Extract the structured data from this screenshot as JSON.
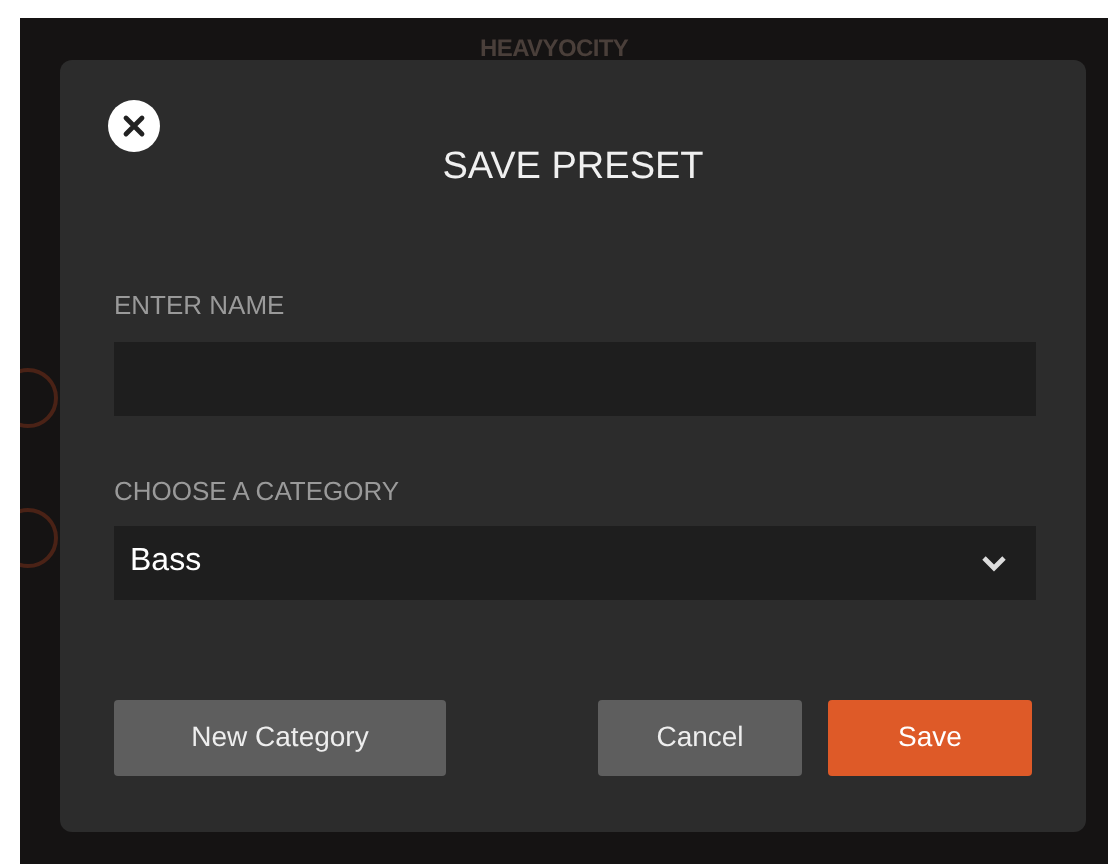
{
  "background": {
    "brand": "HEAVYOCITY"
  },
  "dialog": {
    "title": "SAVE PRESET",
    "name_field": {
      "label": "ENTER NAME"
    },
    "category_field": {
      "label": "CHOOSE A CATEGORY",
      "value": "Bass"
    },
    "buttons": [
      {
        "label": "New Category",
        "kind": "secondary"
      },
      {
        "label": "Cancel",
        "kind": "secondary"
      },
      {
        "label": "Save",
        "kind": "primary"
      }
    ]
  }
}
